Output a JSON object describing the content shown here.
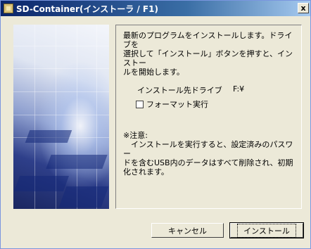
{
  "window": {
    "title": "SD-Container(インストーラ / F1)",
    "close_label": "x"
  },
  "content": {
    "description": "最新のプログラムをインストールします。ドライブを\n選択して「インストール」ボタンを押すと、インストー\nルを開始します。",
    "drive_label": "インストール先ドライブ",
    "drive_value": "F:¥",
    "format_label": "フォーマット実行",
    "format_checked": false,
    "note": "※注意:\n　インストールを実行すると、設定済みのパスワー\nドを含むUSB内のデータはすべて削除され、初期\n化されます。"
  },
  "buttons": {
    "cancel_label": "キャンセル",
    "install_label": "インストール"
  }
}
